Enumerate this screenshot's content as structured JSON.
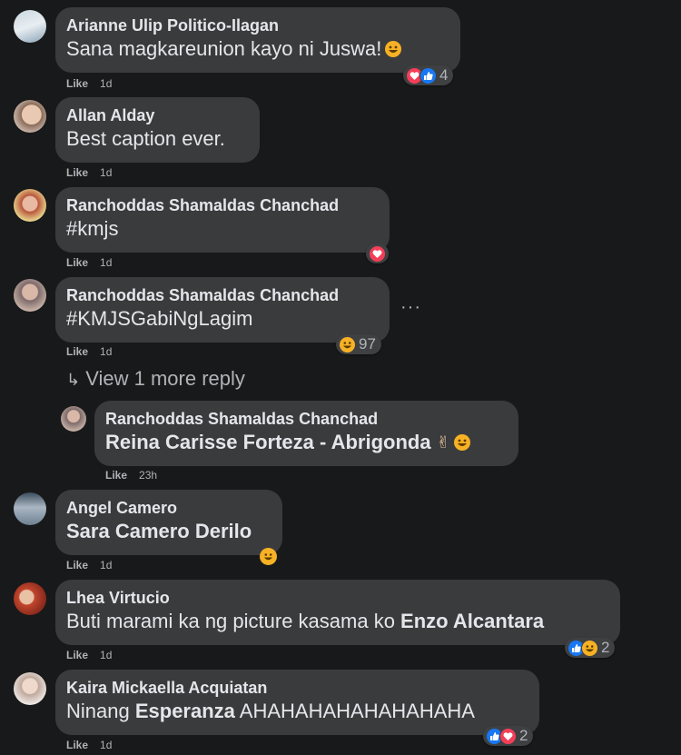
{
  "comments": [
    {
      "author": "Arianne Ulip Politico-Ilagan",
      "text": "Sana magkareunion kayo ni Juswa!",
      "like": "Like",
      "time": "1d",
      "reaction_count": "4"
    },
    {
      "author": "Allan Alday",
      "text": "Best caption ever.",
      "like": "Like",
      "time": "1d"
    },
    {
      "author": "Ranchoddas Shamaldas Chanchad",
      "text": "#kmjs",
      "like": "Like",
      "time": "1d"
    },
    {
      "author": "Ranchoddas Shamaldas Chanchad",
      "text": "#KMJSGabiNgLagim",
      "like": "Like",
      "time": "1d",
      "reaction_count": "97",
      "more": "···"
    },
    {
      "author": "Angel Camero",
      "text": "Sara Camero Derilo",
      "like": "Like",
      "time": "1d"
    },
    {
      "author": "Lhea Virtucio",
      "text_prefix": "Buti marami ka ng picture kasama ko ",
      "mention": "Enzo Alcantara",
      "like": "Like",
      "time": "1d",
      "reaction_count": "2"
    },
    {
      "author": "Kaira Mickaella Acquiatan",
      "text_prefix": "Ninang ",
      "mention": "Esperanza",
      "text_suffix": " AHAHAHAHAHAHAHAHA",
      "like": "Like",
      "time": "1d",
      "reaction_count": "2"
    }
  ],
  "view_more": {
    "arrow": "↳",
    "label": "View 1 more reply"
  },
  "reply": {
    "author": "Ranchoddas Shamaldas Chanchad",
    "text": "Reina Carisse Forteza - Abrigonda",
    "peace": "✌",
    "like": "Like",
    "time": "23h"
  },
  "icons": {
    "heart": "heart-reaction-icon",
    "like": "like-reaction-icon",
    "haha": "haha-reaction-icon"
  },
  "colors": {
    "background": "#18191a",
    "bubble": "#3a3b3c",
    "heart": "#f33e58",
    "like": "#1877f2",
    "haha": "#f7b125"
  }
}
